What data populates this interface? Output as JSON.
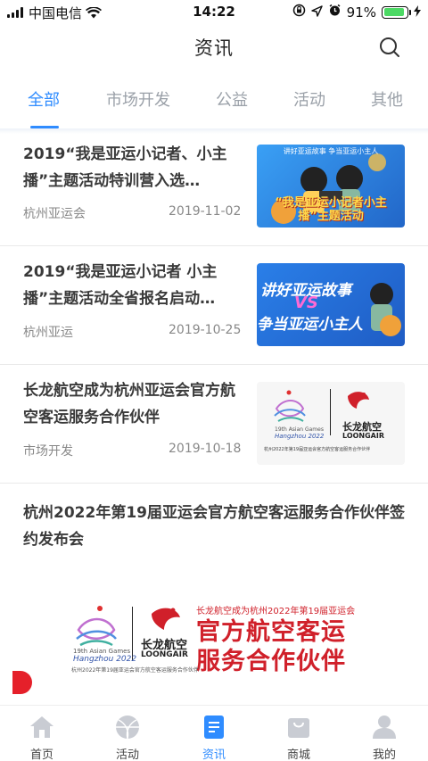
{
  "status_bar": {
    "carrier": "中国电信",
    "time": "14:22",
    "battery": "91%",
    "battery_level": 0.91
  },
  "header": {
    "title": "资讯"
  },
  "tabs": [
    {
      "label": "全部",
      "active": true
    },
    {
      "label": "市场开发",
      "active": false
    },
    {
      "label": "公益",
      "active": false
    },
    {
      "label": "活动",
      "active": false
    },
    {
      "label": "其他",
      "active": false
    }
  ],
  "news": [
    {
      "title": "2019“我是亚运小记者、小主播”主题活动特训营入选…",
      "source": "杭州亚运会",
      "date": "2019-11-02",
      "thumb_top_text": "讲好亚运故事  争当亚运小主人",
      "thumb_text": "“我是亚运小记者小主播”主题活动"
    },
    {
      "title": "2019“我是亚运小记者 小主播”主题活动全省报名启动…",
      "source": "杭州亚运",
      "date": "2019-10-25",
      "thumb_line1": "讲好亚运故事",
      "thumb_vs": "VS",
      "thumb_line2": "争当亚运小主人"
    },
    {
      "title": "长龙航空成为杭州亚运会官方航空客运服务合作伙伴",
      "source": "市场开发",
      "date": "2019-10-18",
      "thumb_games": "19th Asian Games",
      "thumb_city": "Hangzhou 2022",
      "thumb_brand_cn": "长龙航空",
      "thumb_brand_en": "LOONGAIR",
      "thumb_caption": "杭州2022年第19届亚运会官方航空客运服务合作伙伴"
    },
    {
      "title": "杭州2022年第19届亚运会官方航空客运服务合作伙伴签约发布会"
    }
  ],
  "banner": {
    "small_text": "长龙航空成为杭州2022年第19届亚运会",
    "big_line1": "官方航空客运",
    "big_line2": "服务合作伙伴",
    "games": "19th Asian Games",
    "city": "Hangzhou 2022",
    "brand_cn": "长龙航空",
    "brand_en": "LOONGAIR",
    "caption": "杭州2022年第19届亚运会官方航空客运服务合作伙伴"
  },
  "bottom_nav": [
    {
      "label": "首页",
      "icon": "home-icon",
      "active": false
    },
    {
      "label": "活动",
      "icon": "ball-icon",
      "active": false
    },
    {
      "label": "资讯",
      "icon": "news-icon",
      "active": true
    },
    {
      "label": "商城",
      "icon": "shop-icon",
      "active": false
    },
    {
      "label": "我的",
      "icon": "profile-icon",
      "active": false
    }
  ],
  "colors": {
    "accent": "#2f8cff",
    "brand_red": "#d0202a",
    "inactive_icon": "#c9ccd3"
  }
}
